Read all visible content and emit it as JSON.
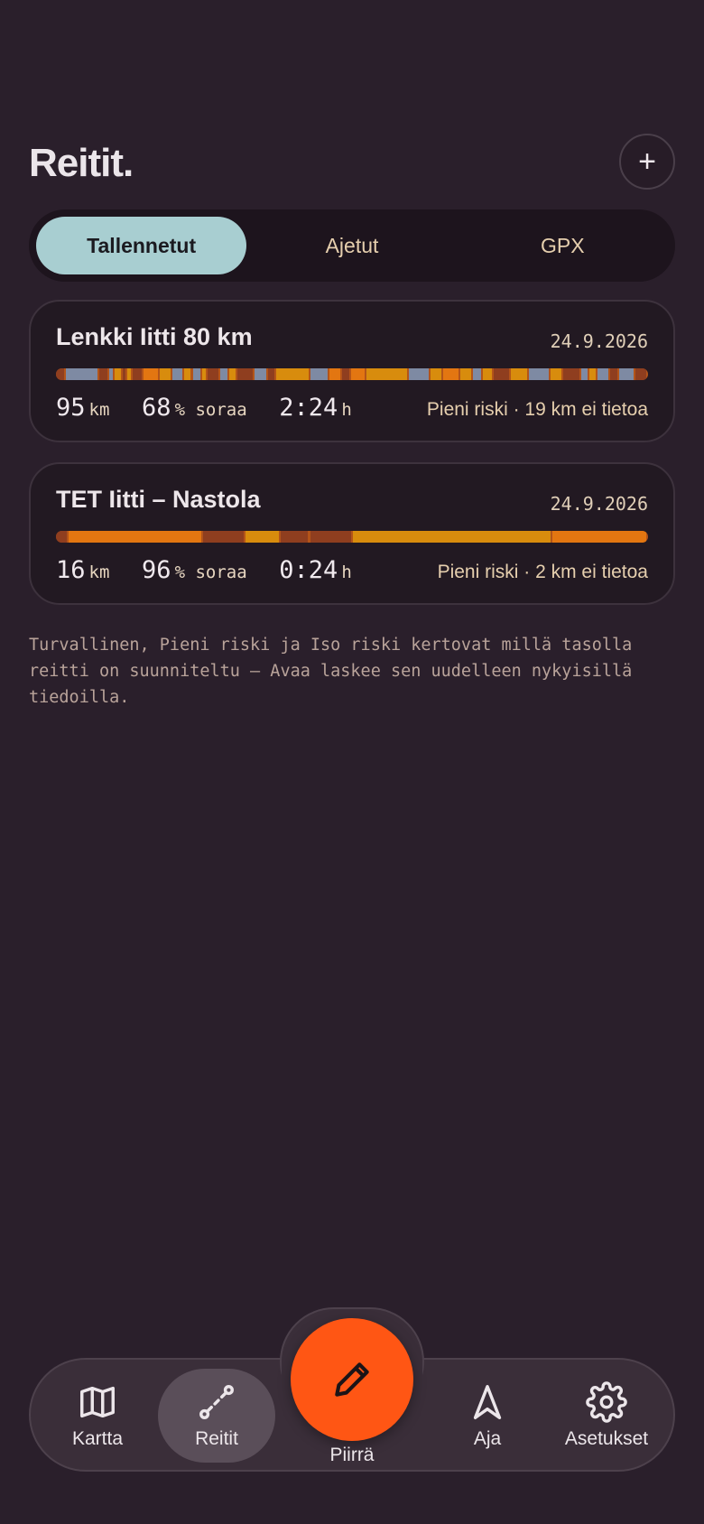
{
  "header": {
    "title": "Reitit.",
    "add_label": "+"
  },
  "tabs": [
    {
      "label": "Tallennetut",
      "active": true
    },
    {
      "label": "Ajetut",
      "active": false
    },
    {
      "label": "GPX",
      "active": false
    }
  ],
  "colors": {
    "background": "#2a1f2b",
    "accent": "#ff5614",
    "tab_active": "#a8ced1",
    "surface_paved": "#7e8aa3",
    "surface_gravel": "#d88c0d",
    "surface_gravel_rough": "#e37611",
    "surface_unknown": "#8f3e1f"
  },
  "routes": [
    {
      "title": "Lenkki Iitti 80 km",
      "date": "24.9.2026",
      "distance": "95",
      "distance_unit": "km",
      "gravel": "68",
      "gravel_unit": "% soraa",
      "duration": "2:24",
      "duration_unit": "h",
      "risk": "Pieni riski · 19 km ei tietoa",
      "surface_segments": [
        [
          "unknown",
          0.014
        ],
        [
          "paved",
          0.05
        ],
        [
          "unknown",
          0.014
        ],
        [
          "paved",
          0.008
        ],
        [
          "gravel",
          0.012
        ],
        [
          "unknown",
          0.006
        ],
        [
          "gravel",
          0.008
        ],
        [
          "unknown",
          0.016
        ],
        [
          "rough",
          0.024
        ],
        [
          "gravel",
          0.018
        ],
        [
          "paved",
          0.018
        ],
        [
          "gravel",
          0.012
        ],
        [
          "paved",
          0.014
        ],
        [
          "gravel",
          0.008
        ],
        [
          "unknown",
          0.018
        ],
        [
          "paved",
          0.014
        ],
        [
          "gravel",
          0.012
        ],
        [
          "unknown",
          0.024
        ],
        [
          "paved",
          0.02
        ],
        [
          "unknown",
          0.012
        ],
        [
          "gravel",
          0.05
        ],
        [
          "paved",
          0.028
        ],
        [
          "rough",
          0.018
        ],
        [
          "unknown",
          0.014
        ],
        [
          "rough",
          0.022
        ],
        [
          "gravel",
          0.062
        ],
        [
          "paved",
          0.032
        ],
        [
          "gravel",
          0.018
        ],
        [
          "rough",
          0.026
        ],
        [
          "gravel",
          0.018
        ],
        [
          "paved",
          0.014
        ],
        [
          "gravel",
          0.016
        ],
        [
          "unknown",
          0.026
        ],
        [
          "gravel",
          0.026
        ],
        [
          "paved",
          0.032
        ],
        [
          "gravel",
          0.018
        ],
        [
          "unknown",
          0.026
        ],
        [
          "paved",
          0.012
        ],
        [
          "gravel",
          0.012
        ],
        [
          "paved",
          0.018
        ],
        [
          "unknown",
          0.014
        ],
        [
          "paved",
          0.024
        ],
        [
          "unknown",
          0.018
        ]
      ]
    },
    {
      "title": "TET Iitti – Nastola",
      "date": "24.9.2026",
      "distance": "16",
      "distance_unit": "km",
      "gravel": "96",
      "gravel_unit": "% soraa",
      "duration": "0:24",
      "duration_unit": "h",
      "risk": "Pieni riski · 2 km ei tietoa",
      "surface_segments": [
        [
          "unknown",
          0.022
        ],
        [
          "rough",
          0.226
        ],
        [
          "unknown",
          0.072
        ],
        [
          "gravel",
          0.06
        ],
        [
          "unknown",
          0.048
        ],
        [
          "gravel",
          0.002
        ],
        [
          "unknown",
          0.072
        ],
        [
          "gravel",
          0.336
        ],
        [
          "rough",
          0.162
        ]
      ]
    }
  ],
  "note": "Turvallinen, Pieni riski ja Iso riski kertovat millä tasolla reitti on suunniteltu – Avaa laskee sen uudelleen nykyisillä tiedoilla.",
  "nav": {
    "map": "Kartta",
    "routes": "Reitit",
    "draw": "Piirrä",
    "ride": "Aja",
    "settings": "Asetukset"
  }
}
